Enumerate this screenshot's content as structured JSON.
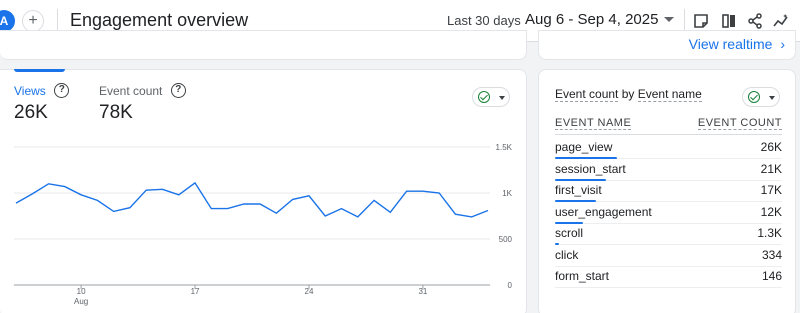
{
  "header": {
    "avatar_letter": "A",
    "add_symbol": "+",
    "title": "Engagement overview",
    "date_label": "Last 30 days",
    "date_range": "Aug 6 - Sep 4, 2025",
    "icons": [
      "report-note-icon",
      "compare-icon",
      "share-icon",
      "insights-icon"
    ]
  },
  "realtime": {
    "link": "View realtime",
    "arrow": "›"
  },
  "main_card": {
    "tabs": [
      {
        "label": "Views",
        "value": "26K",
        "active": true
      },
      {
        "label": "Event count",
        "value": "78K",
        "active": false
      }
    ],
    "help_symbol": "?"
  },
  "right_card": {
    "title_prefix": "Event count",
    "title_by": " by ",
    "title_suffix": "Event name",
    "col_name": "EVENT NAME",
    "col_count": "EVENT COUNT",
    "rows": [
      {
        "name": "page_view",
        "count": "26K",
        "share": 0.33
      },
      {
        "name": "session_start",
        "count": "21K",
        "share": 0.27
      },
      {
        "name": "first_visit",
        "count": "17K",
        "share": 0.22
      },
      {
        "name": "user_engagement",
        "count": "12K",
        "share": 0.15
      },
      {
        "name": "scroll",
        "count": "1.3K",
        "share": 0.02
      },
      {
        "name": "click",
        "count": "334",
        "share": 0.0
      },
      {
        "name": "form_start",
        "count": "146",
        "share": 0.0
      }
    ]
  },
  "colors": {
    "accent": "#1a73e8",
    "ok": "#188038"
  },
  "chart_data": {
    "type": "line",
    "x": [
      "Aug 6",
      "Aug 7",
      "Aug 8",
      "Aug 9",
      "Aug 10",
      "Aug 11",
      "Aug 12",
      "Aug 13",
      "Aug 14",
      "Aug 15",
      "Aug 16",
      "Aug 17",
      "Aug 18",
      "Aug 19",
      "Aug 20",
      "Aug 21",
      "Aug 22",
      "Aug 23",
      "Aug 24",
      "Aug 25",
      "Aug 26",
      "Aug 27",
      "Aug 28",
      "Aug 29",
      "Aug 30",
      "Aug 31",
      "Sep 1",
      "Sep 2",
      "Sep 3",
      "Sep 4"
    ],
    "series": [
      {
        "values": [
          890,
          990,
          1100,
          1070,
          980,
          920,
          800,
          840,
          1030,
          1040,
          980,
          1110,
          830,
          830,
          880,
          880,
          780,
          930,
          970,
          750,
          830,
          740,
          920,
          790,
          1020,
          1020,
          1000,
          770,
          740,
          810
        ]
      }
    ],
    "ylim": [
      0,
      1500
    ],
    "y_ticks": [
      "0",
      "500",
      "1K",
      "1.5K"
    ],
    "x_ticks": [
      {
        "label": "10",
        "sub": "Aug",
        "index": 4
      },
      {
        "label": "17",
        "sub": "",
        "index": 11
      },
      {
        "label": "24",
        "sub": "",
        "index": 18
      },
      {
        "label": "31",
        "sub": "",
        "index": 25
      }
    ],
    "grid": true
  }
}
